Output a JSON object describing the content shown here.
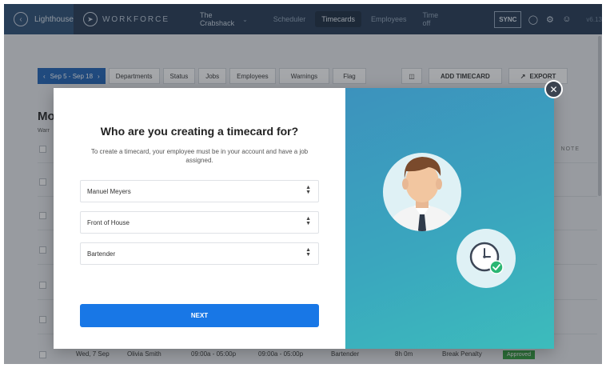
{
  "nav": {
    "home_label": "Lighthouse",
    "brand": "WORKFORCE",
    "location": "The Crabshack",
    "tabs": [
      "Scheduler",
      "Timecards",
      "Employees",
      "Time off"
    ],
    "active_tab": "Timecards",
    "sync_label": "SYNC",
    "version": "v6.13"
  },
  "toolbar": {
    "date_range": "Sep 5 - Sep 18",
    "filters": [
      "Departments",
      "Status",
      "Jobs",
      "Employees",
      "Warnings",
      "Flag"
    ],
    "add_label": "ADD TIMECARD",
    "export_label": "EXPORT"
  },
  "page": {
    "heading": "Mo",
    "sub": "Warr",
    "notes_col": "NOTE"
  },
  "bg_row": {
    "date": "Wed, 7 Sep",
    "name": "Olivia Smith",
    "sched": "09:00a - 05:00p",
    "actual": "09:00a - 05:00p",
    "job": "Bartender",
    "hours": "8h 0m",
    "warning": "Break Penalty",
    "status": "Approved"
  },
  "modal": {
    "title": "Who are you creating a timecard for?",
    "description": "To create a timecard, your employee must be in your account and have a job assigned.",
    "employee": "Manuel Meyers",
    "department": "Front of House",
    "job": "Bartender",
    "next_label": "NEXT"
  },
  "colors": {
    "nav_bg": "#1f3550",
    "primary": "#1877e6",
    "panel_gradient_start": "#3c92bd",
    "panel_gradient_end": "#3cbcbc",
    "status_green": "#2e9b3a"
  }
}
